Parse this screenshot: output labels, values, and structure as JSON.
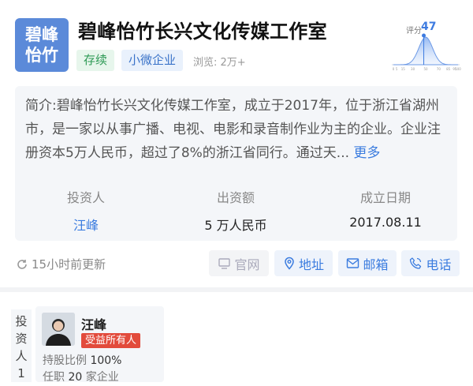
{
  "company": {
    "logo_text": "碧峰怡竹",
    "name": "碧峰怡竹长兴文化传媒工作室",
    "status_tag": "存续",
    "scale_tag": "小微企业",
    "views": "浏览: 2万+"
  },
  "score": {
    "label": "评分",
    "value": "47",
    "value_number": 47,
    "axis_ticks": [
      "0",
      "5",
      "15",
      "30",
      "50",
      "70",
      "85",
      "95",
      "100"
    ]
  },
  "intro": {
    "prefix": "简介:",
    "text": "碧峰怡竹长兴文化传媒工作室，成立于2017年，位于浙江省湖州市，是一家以从事广播、电视、电影和录音制作业为主的企业。企业注册资本5万人民币，超过了8%的浙江省同行。通过天...",
    "more": "更多"
  },
  "stats": [
    {
      "label": "投资人",
      "value": "汪峰"
    },
    {
      "label": "出资额",
      "value": "5 万人民币"
    },
    {
      "label": "成立日期",
      "value": "2017.08.11"
    }
  ],
  "updated": "15小时前更新",
  "actions": {
    "website": "官网",
    "address": "地址",
    "email": "邮箱",
    "phone": "电话"
  },
  "investor_section": {
    "side_label": [
      "投",
      "资",
      "人",
      "1"
    ],
    "name": "汪峰",
    "badge": "受益所有人",
    "share_label": "持股比例",
    "share_value": "100%",
    "jobs_label": "任职",
    "jobs_value": "20",
    "jobs_suffix": "家企业"
  },
  "colors": {
    "accent": "#3b7cdf",
    "logo_bg": "#5b8ad9",
    "status_green": "#2e9a55",
    "badge_red": "#e24b3c"
  }
}
